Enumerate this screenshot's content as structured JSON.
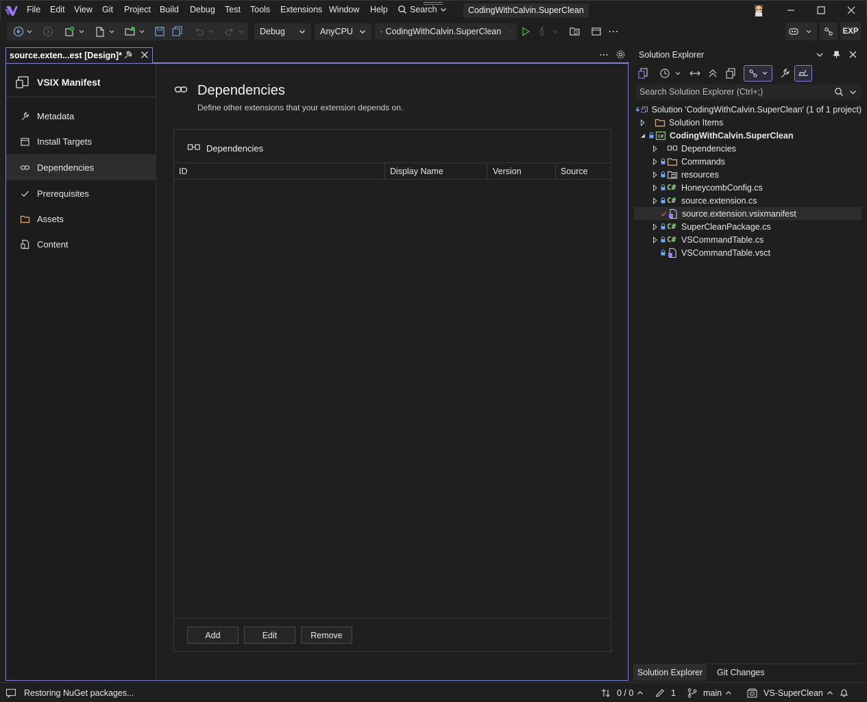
{
  "menu": {
    "items": [
      "File",
      "Edit",
      "View",
      "Git",
      "Project",
      "Build",
      "Debug",
      "Test",
      "Tools",
      "Extensions",
      "Window",
      "Help"
    ],
    "search_label": "Search",
    "solution_name": "CodingWithCalvin.SuperClean"
  },
  "toolbar": {
    "configuration": "Debug",
    "platform": "AnyCPU",
    "start_target": "CodingWithCalvin.SuperClean",
    "exp_badge": "EXP"
  },
  "document_tab": {
    "title": "source.exten...est [Design]*"
  },
  "manifest": {
    "header": "VSIX Manifest",
    "nav": [
      {
        "label": "Metadata",
        "icon": "wrench-icon"
      },
      {
        "label": "Install Targets",
        "icon": "target-icon"
      },
      {
        "label": "Dependencies",
        "icon": "link-icon",
        "selected": true
      },
      {
        "label": "Prerequisites",
        "icon": "checkmark-icon"
      },
      {
        "label": "Assets",
        "icon": "folder-icon"
      },
      {
        "label": "Content",
        "icon": "document-icon"
      }
    ],
    "page_title": "Dependencies",
    "page_description": "Define other extensions that your extension depends on.",
    "panel_title": "Dependencies",
    "columns": [
      "ID",
      "Display Name",
      "Version",
      "Source"
    ],
    "rows": [],
    "buttons": {
      "add": "Add",
      "edit": "Edit",
      "remove": "Remove"
    }
  },
  "solution_explorer": {
    "title": "Solution Explorer",
    "search_placeholder": "Search Solution Explorer (Ctrl+;)",
    "tree": [
      {
        "label": "Solution 'CodingWithCalvin.SuperClean' (1 of 1 project)",
        "icon": "solution-icon"
      },
      {
        "label": "Solution Items",
        "icon": "folder-icon"
      },
      {
        "label": "CodingWithCalvin.SuperClean",
        "icon": "csproj-icon"
      },
      {
        "label": "Dependencies",
        "icon": "dependencies-icon"
      },
      {
        "label": "Commands",
        "icon": "folder-icon"
      },
      {
        "label": "resources",
        "icon": "folder-icon"
      },
      {
        "label": "HoneycombConfig.cs",
        "icon": "csharp-icon"
      },
      {
        "label": "source.extension.cs",
        "icon": "csharp-icon"
      },
      {
        "label": "source.extension.vsixmanifest",
        "icon": "manifest-icon",
        "selected": true
      },
      {
        "label": "SuperCleanPackage.cs",
        "icon": "csharp-icon"
      },
      {
        "label": "VSCommandTable.cs",
        "icon": "csharp-icon"
      },
      {
        "label": "VSCommandTable.vsct",
        "icon": "vsct-icon"
      }
    ],
    "csharp_glyph": "C#",
    "tabs": [
      "Solution Explorer",
      "Git Changes"
    ]
  },
  "status_bar": {
    "message": "Restoring NuGet packages...",
    "sync": "0 / 0",
    "pending_edits": "1",
    "branch": "main",
    "repo": "VS-SuperClean"
  },
  "colors": {
    "accent": "#7f83d6",
    "vs_purple": "#9a7cf6",
    "play_green": "#3fb950"
  }
}
